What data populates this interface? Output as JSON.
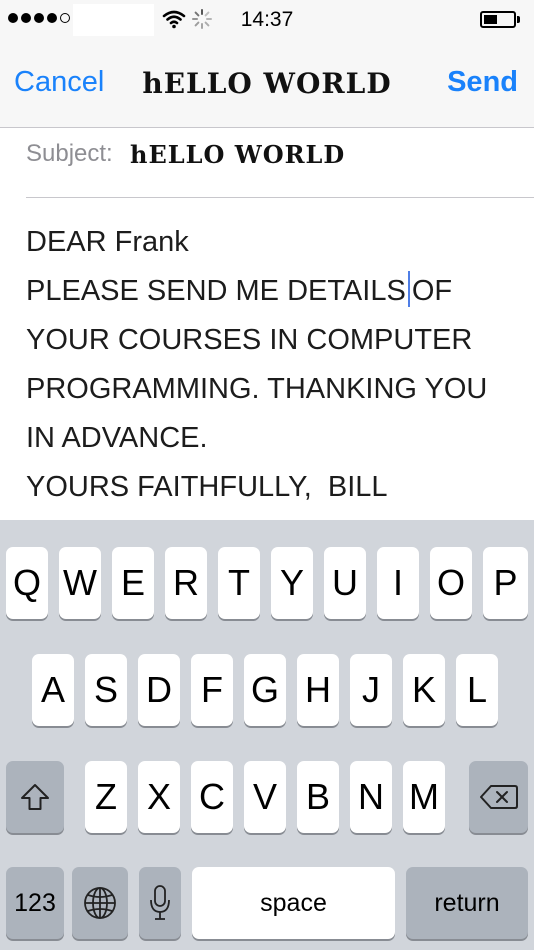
{
  "status_bar": {
    "time": "14:37",
    "signal_strength": "4 of 5",
    "icons": [
      "wifi-icon",
      "activity-spinner-icon",
      "battery-icon"
    ]
  },
  "nav": {
    "cancel": "Cancel",
    "title": "hELLO WORLD",
    "send": "Send"
  },
  "subject": {
    "label": "Subject:",
    "value": "hELLO WORLD"
  },
  "body": {
    "greeting": "DEAR Frank",
    "line2_before_cursor": "PLEASE SEND ME DETAILS",
    "line2_after_cursor": "OF",
    "line3": "YOUR COURSES IN COMPUTER",
    "line4": "PROGRAMMING. THANKING YOU",
    "line5": "IN ADVANCE.",
    "line6": "YOURS FAITHFULLY,  BILL"
  },
  "keyboard": {
    "row1": [
      "Q",
      "W",
      "E",
      "R",
      "T",
      "Y",
      "U",
      "I",
      "O",
      "P"
    ],
    "row2": [
      "A",
      "S",
      "D",
      "F",
      "G",
      "H",
      "J",
      "K",
      "L"
    ],
    "row3": [
      "Z",
      "X",
      "C",
      "V",
      "B",
      "N",
      "M"
    ],
    "shift_icon": "shift-icon",
    "delete_icon": "delete-icon",
    "numbers": "123",
    "globe_icon": "globe-icon",
    "mic_icon": "microphone-icon",
    "space": "space",
    "return": "return"
  },
  "colors": {
    "accent": "#1a82fb",
    "keyboard_bg": "#d1d5db",
    "function_key": "#acb3bc",
    "cursor": "#4f7ee6"
  }
}
